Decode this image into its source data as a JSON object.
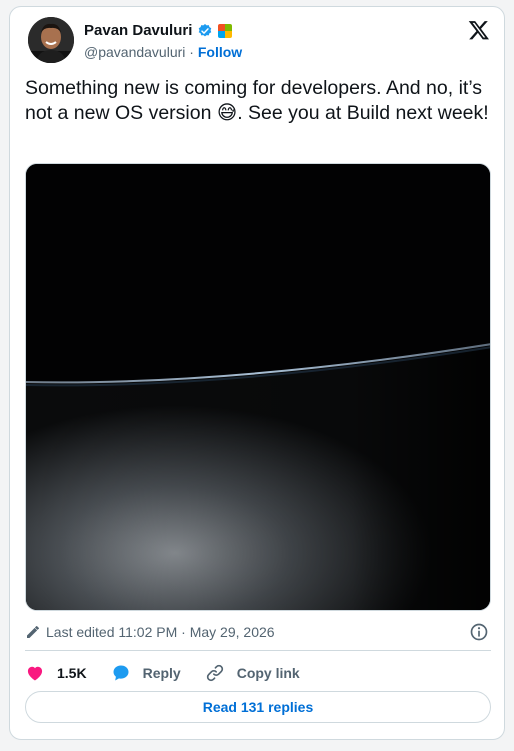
{
  "author": {
    "name": "Pavan Davuluri",
    "handle": "@pavandavuluri",
    "separator": "·",
    "follow_label": "Follow"
  },
  "tweet": {
    "text_before_emoji": "Something new is coming for developers. And no, it’s not a new OS version ",
    "emoji": "😅",
    "text_after_emoji": ". See you at Build next week!"
  },
  "meta": {
    "edited_label": "Last edited 11:02 PM · May 29, 2026"
  },
  "actions": {
    "likes": "1.5K",
    "reply_label": "Reply",
    "copy_link_label": "Copy link"
  },
  "read_replies_label": "Read 131 replies",
  "colors": {
    "accent": "#006fd6",
    "like": "#f91880",
    "verified": "#1d9bf0",
    "border": "#cfd9de",
    "secondary_text": "#536471"
  },
  "icons": [
    "x-logo-icon",
    "verified-badge-icon",
    "affiliate-badge-icon",
    "pencil-icon",
    "info-icon",
    "heart-icon",
    "reply-bubble-icon",
    "link-icon"
  ]
}
